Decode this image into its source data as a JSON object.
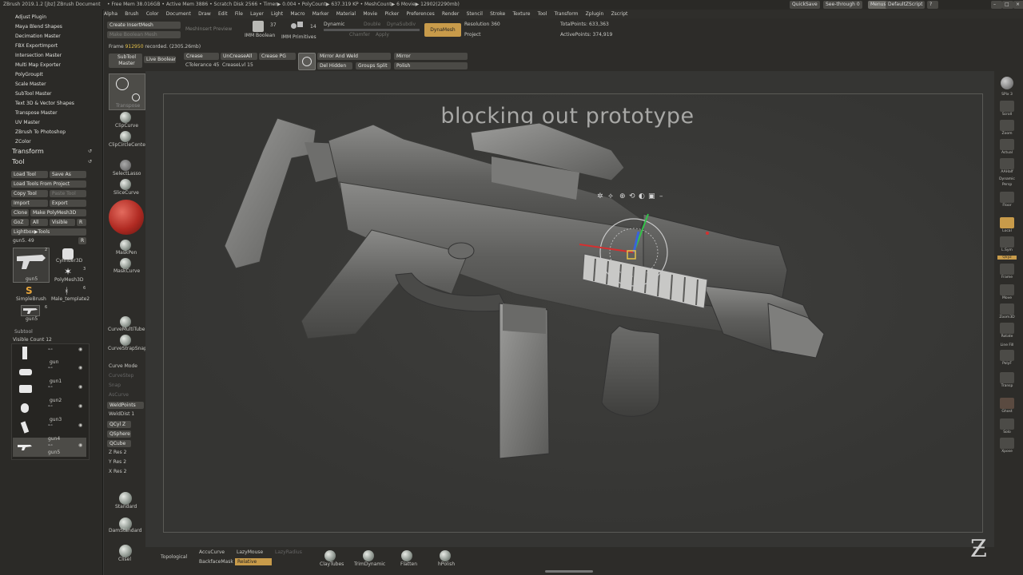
{
  "titlebar": {
    "app": "ZBrush 2019.1.2 [jbz]  ZBrush Document",
    "stats": "• Free Mem 38.016GB • Active Mem 3886 • Scratch Disk 2566 • Timer▶ 0.004 • PolyCount▶ 637.319 KP • MeshCount▶ 6  Movie▶ 12902(2290mb)",
    "quicksave": "QuickSave",
    "seethrough": "See-through  0",
    "menus": "Menus",
    "script": "DefaultZScript"
  },
  "menu": [
    "Alpha",
    "Brush",
    "Color",
    "Document",
    "Draw",
    "Edit",
    "File",
    "Layer",
    "Light",
    "Macro",
    "Marker",
    "Material",
    "Movie",
    "Picker",
    "Preferences",
    "Render",
    "Stencil",
    "Stroke",
    "Texture",
    "Tool",
    "Transform",
    "Zplugin",
    "Zscript"
  ],
  "plugins": [
    "Adjust Plugin",
    "Maya Blend Shapes",
    "Decimation Master",
    "FBX ExportImport",
    "Intersection Master",
    "Multi Map Exporter",
    "PolyGroupIt",
    "Scale Master",
    "SubTool Master",
    "Text 3D & Vector Shapes",
    "Transpose Master",
    "UV Master",
    "ZBrush To Photoshop",
    "ZColor"
  ],
  "sections": {
    "transform": "Transform",
    "tool": "Tool",
    "subtool": "Subtool"
  },
  "toolpanel": {
    "load_tool": "Load Tool",
    "save_as": "Save As",
    "load_from_project": "Load Tools From Project",
    "copy_tool": "Copy Tool",
    "paste_tool": "Paste Tool",
    "import": "Import",
    "export": "Export",
    "clone": "Clone",
    "make_polymesh": "Make PolyMesh3D",
    "goz": "GoZ",
    "all": "All",
    "visible": "Visible",
    "r": "R",
    "lightbox_tools": "Lightbox▶Tools",
    "current_tool": "gun5. 49",
    "thumbs": [
      {
        "label": "gun5"
      },
      {
        "label": "Cylinder3D"
      },
      {
        "label": "PolyMesh3D"
      },
      {
        "label": "SimpleBrush"
      },
      {
        "label": "Male_template2"
      },
      {
        "label": "gun5"
      }
    ],
    "thumb_counts": [
      "2",
      "3",
      "6",
      "6"
    ]
  },
  "subtool": {
    "visible_count": "Visible Count 12",
    "items": [
      "",
      "gun",
      "gun1",
      "gun2",
      "gun3",
      "gun4",
      "gun5"
    ]
  },
  "shelf": {
    "create_insertmesh": "Create InsertMesh",
    "make_boolean_mesh": "Make Boolean Mesh",
    "meshinsert_preview": "MeshInsert Preview",
    "imm_boolean": "IMM Boolean",
    "imm_primitives": "IMM Primitives",
    "imm_count": "37",
    "imm_count2": "14",
    "dynamic": "Dynamic",
    "double": "Double",
    "dynasubdiv": "DynaSubdiv",
    "chamfer": "Chamfer",
    "apply": "Apply",
    "dynamesh": "DynaMesh",
    "resolution": "Resolution 360",
    "project": "Project",
    "total_points": "TotalPoints: 633,363",
    "active_points": "ActivePoints: 374,919",
    "frame_prefix": "Frame ",
    "frame_value": "912950",
    "frame_suffix": " recorded. (2305.26mb)",
    "subtool_master": "SubTool Master",
    "live_boolean": "Live Boolean",
    "crease": "Crease",
    "uncrease_all": "UnCreaseAll",
    "crease_pg": "Crease PG",
    "ctolerance": "CTolerance 45",
    "createlvl": "CreaseLvl 15",
    "mirror_and_weld": "Mirror And Weld",
    "mirror": "Mirror",
    "del_hidden": "Del Hidden",
    "groups_split": "Groups Split",
    "polish": "Polish"
  },
  "leftcol": [
    "Transpose",
    "ClipCurve",
    "ClipCircleCenter",
    "SelectLasso",
    "SliceCurve",
    "MaskPen",
    "MaskCurve",
    "CurveMultiTube",
    "CurveStrapSnap",
    "Curve Mode",
    "CurveStep",
    "Snap",
    "AsCurve",
    "WeldPoints",
    "WeldDist 1",
    "QCyl Z",
    "QSphere",
    "QCube",
    "Z Res 2",
    "Y Res 2",
    "X Res 2",
    "Standard",
    "DamStandard",
    "Clisel"
  ],
  "rightcol": [
    "SPix 3",
    "Scroll",
    "Zoom",
    "Actual",
    "AAHalf",
    "Dynamic",
    "Persp",
    "Floor",
    "Local",
    "L.Sym",
    "Qxyz",
    "Frame",
    "Move",
    "Zoom3D",
    "Rotate",
    "Line Fill",
    "PolyF",
    "Transp",
    "Ghost",
    "Solo",
    "Xpose"
  ],
  "canvas": {
    "caption": "blocking out prototype"
  },
  "bottom": {
    "topological": "Topological",
    "accucurve": "AccuCurve",
    "lazymouse": "LazyMouse",
    "lazyradius": "LazyRadius",
    "backfacemask": "BackfaceMask",
    "relative": "Relative",
    "brushes": [
      "ClayTubes",
      "TrimDynamic",
      "Flatten",
      "hPolish"
    ]
  },
  "colors": {
    "accent": "#c89b4a",
    "panel": "#2d2c29",
    "canvas": "#353533",
    "button": "#4b4a46",
    "material": "#b02a22"
  }
}
